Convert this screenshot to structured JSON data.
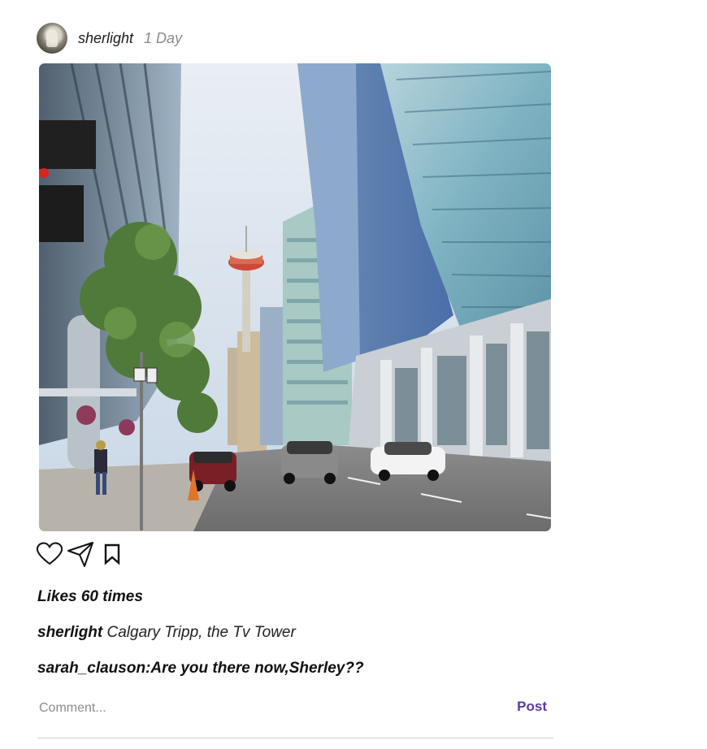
{
  "post": {
    "author": "sherlight",
    "time": "1 Day",
    "likes_text": "Likes 60 times",
    "caption": {
      "user": "sherlight",
      "text": "Calgary Tripp, the Tv Tower"
    },
    "comments": [
      {
        "text": "sarah_clauson:Are you there now,Sherley??"
      }
    ],
    "comment_input": {
      "placeholder": "Comment...",
      "value": ""
    },
    "post_button_label": "Post",
    "actions": [
      "heart-icon",
      "send-icon",
      "bookmark-icon"
    ]
  },
  "colors": {
    "post_button": "#5b3aa6",
    "time_text": "#8a8a8a",
    "divider": "#cfcfcf"
  }
}
